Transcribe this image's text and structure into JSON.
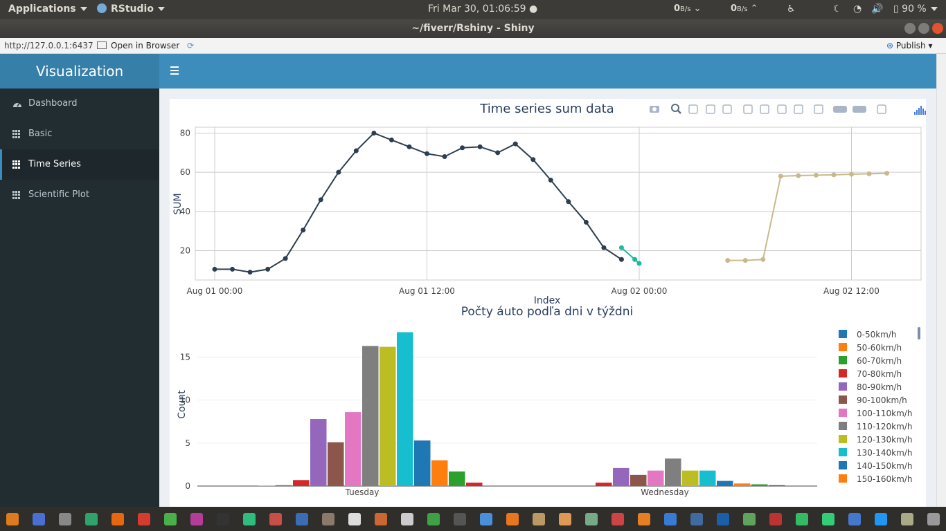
{
  "os": {
    "applications": "Applications",
    "app": "RStudio",
    "clock": "Fri Mar 30, 01:06:59",
    "net_down": "0",
    "net_up": "0",
    "net_unit": "B/s",
    "battery": "90 %"
  },
  "window": {
    "title": "~/fiverr/Rshiny - Shiny"
  },
  "viewer": {
    "url": "http://127.0.0.1:6437",
    "open_browser": "Open in Browser",
    "publish": "Publish"
  },
  "app": {
    "title": "Visualization"
  },
  "sidebar": {
    "items": [
      {
        "label": "Dashboard",
        "icon": "dashboard-icon"
      },
      {
        "label": "Basic",
        "icon": "th-icon"
      },
      {
        "label": "Time Series",
        "icon": "th-icon",
        "active": true
      },
      {
        "label": "Scientific Plot",
        "icon": "th-icon"
      }
    ]
  },
  "plotly_modebar": [
    "camera-icon",
    "zoom-icon",
    "pan-icon",
    "box-select-icon",
    "lasso-icon",
    "zoom-in-icon",
    "zoom-out-icon",
    "autoscale-icon",
    "reset-axes-icon",
    "spike-lines-icon",
    "hover-closest-icon",
    "hover-compare-icon",
    "edit-chart-icon",
    "plotly-logo-icon"
  ],
  "chart_data": [
    {
      "type": "line",
      "title": "Time series sum data",
      "xlabel": "Index",
      "ylabel": "SUM",
      "x_ticks": [
        "Aug 01 00:00",
        "Aug 01 12:00",
        "Aug 02 00:00",
        "Aug 02 12:00"
      ],
      "y_ticks": [
        20,
        40,
        60,
        80
      ],
      "ylim": [
        5,
        83
      ],
      "series": [
        {
          "color": "#2c3e50",
          "x": [
            "Aug 01 00:00",
            "Aug 01 01:00",
            "Aug 01 02:00",
            "Aug 01 03:00",
            "Aug 01 04:00",
            "Aug 01 05:00",
            "Aug 01 06:00",
            "Aug 01 07:00",
            "Aug 01 08:00",
            "Aug 01 09:00",
            "Aug 01 10:00",
            "Aug 01 11:00",
            "Aug 01 12:00",
            "Aug 01 13:00",
            "Aug 01 14:00",
            "Aug 01 15:00",
            "Aug 01 16:00",
            "Aug 01 17:00",
            "Aug 01 18:00",
            "Aug 01 19:00",
            "Aug 01 20:00",
            "Aug 01 21:00",
            "Aug 01 22:00",
            "Aug 01 23:00"
          ],
          "values": [
            10.5,
            10.5,
            9,
            10.5,
            16,
            30.5,
            46,
            60,
            71,
            80,
            76.5,
            73,
            69.5,
            68,
            72.5,
            73,
            70,
            74.5,
            66.5,
            56,
            45,
            34.5,
            21.5,
            15.5
          ]
        },
        {
          "color": "#1abc9c",
          "x": [
            "Aug 01 23:00",
            "Aug 01 23:45",
            "Aug 02 00:00"
          ],
          "values": [
            21.5,
            15.5,
            13.5
          ]
        },
        {
          "color": "#c9b98a",
          "x": [
            "Aug 02 05:00",
            "Aug 02 06:00",
            "Aug 02 07:00",
            "Aug 02 08:00",
            "Aug 02 09:00",
            "Aug 02 10:00",
            "Aug 02 11:00",
            "Aug 02 12:00",
            "Aug 02 13:00",
            "Aug 02 14:00"
          ],
          "values": [
            15,
            15,
            15.5,
            58,
            58.3,
            58.5,
            58.7,
            59,
            59.2,
            59.5
          ]
        }
      ]
    },
    {
      "type": "bar",
      "title": "Počty áuto podľa dni v týždni",
      "xlabel": "",
      "ylabel": "Count",
      "categories": [
        "Tuesday",
        "Wednesday"
      ],
      "y_ticks": [
        0,
        5,
        10,
        15
      ],
      "ylim": [
        0,
        18.5
      ],
      "series": [
        {
          "name": "0-50km/h",
          "color": "#1f77b4",
          "values": [
            0.05,
            0
          ]
        },
        {
          "name": "50-60km/h",
          "color": "#ff7f0e",
          "values": [
            0.05,
            0
          ]
        },
        {
          "name": "60-70km/h",
          "color": "#2ca02c",
          "values": [
            0.1,
            0
          ]
        },
        {
          "name": "70-80km/h",
          "color": "#d62728",
          "values": [
            0.7,
            0.4
          ]
        },
        {
          "name": "80-90km/h",
          "color": "#9467bd",
          "values": [
            7.8,
            2.1
          ]
        },
        {
          "name": "90-100km/h",
          "color": "#8c564b",
          "values": [
            5.1,
            1.3
          ]
        },
        {
          "name": "100-110km/h",
          "color": "#e377c2",
          "values": [
            8.6,
            1.8
          ]
        },
        {
          "name": "110-120km/h",
          "color": "#7f7f7f",
          "values": [
            16.3,
            3.2
          ]
        },
        {
          "name": "120-130km/h",
          "color": "#bcbd22",
          "values": [
            16.2,
            1.8
          ]
        },
        {
          "name": "130-140km/h",
          "color": "#17becf",
          "values": [
            17.9,
            1.8
          ]
        },
        {
          "name": "140-150km/h",
          "color": "#1f77b4",
          "values": [
            5.3,
            0.6
          ]
        },
        {
          "name": "150-160km/h",
          "color": "#ff7f0e",
          "values": [
            3,
            0.3
          ]
        },
        {
          "name": "",
          "color": "#2ca02c",
          "values": [
            1.7,
            0.2
          ]
        },
        {
          "name": "",
          "color": "#d62728",
          "values": [
            0.4,
            0.1
          ]
        }
      ]
    }
  ]
}
